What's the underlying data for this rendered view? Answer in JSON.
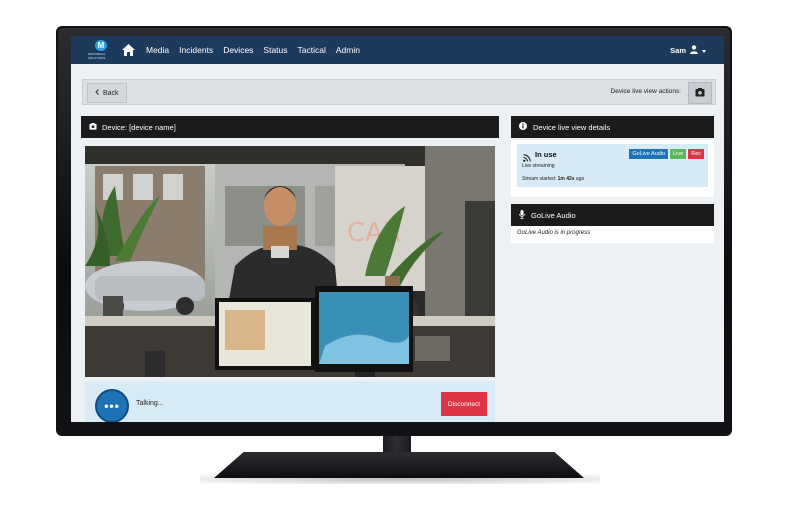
{
  "nav": {
    "logo_letter": "M",
    "logo_text": "MOTOROLA SOLUTIONS",
    "items": [
      "Media",
      "Incidents",
      "Devices",
      "Status",
      "Tactical",
      "Admin"
    ],
    "user": "Sam"
  },
  "action_bar": {
    "back_label": "Back",
    "actions_label": "Device live view actions:"
  },
  "device_panel": {
    "title": "Device: [device name]"
  },
  "talk_bar": {
    "button_glyph": "•••",
    "status_text": "Talking...",
    "disconnect_label": "Disconnect"
  },
  "details_panel": {
    "title": "Device live view details",
    "status": "In use",
    "substatus": "Live streaming",
    "stream_started_prefix": "Stream started: ",
    "stream_started_value": "1m 42s",
    "stream_started_suffix": " ago",
    "badges": [
      "GoLive Audio",
      "Live",
      "Rec"
    ]
  },
  "audio_panel": {
    "title": "GoLive Audio",
    "text": "GoLive Audio is in progress"
  },
  "colors": {
    "nav_bg": "#1c3a5c",
    "primary": "#1e73b5",
    "danger": "#dc3545",
    "success": "#5cb85c",
    "info_bg": "#d7eaf6"
  }
}
